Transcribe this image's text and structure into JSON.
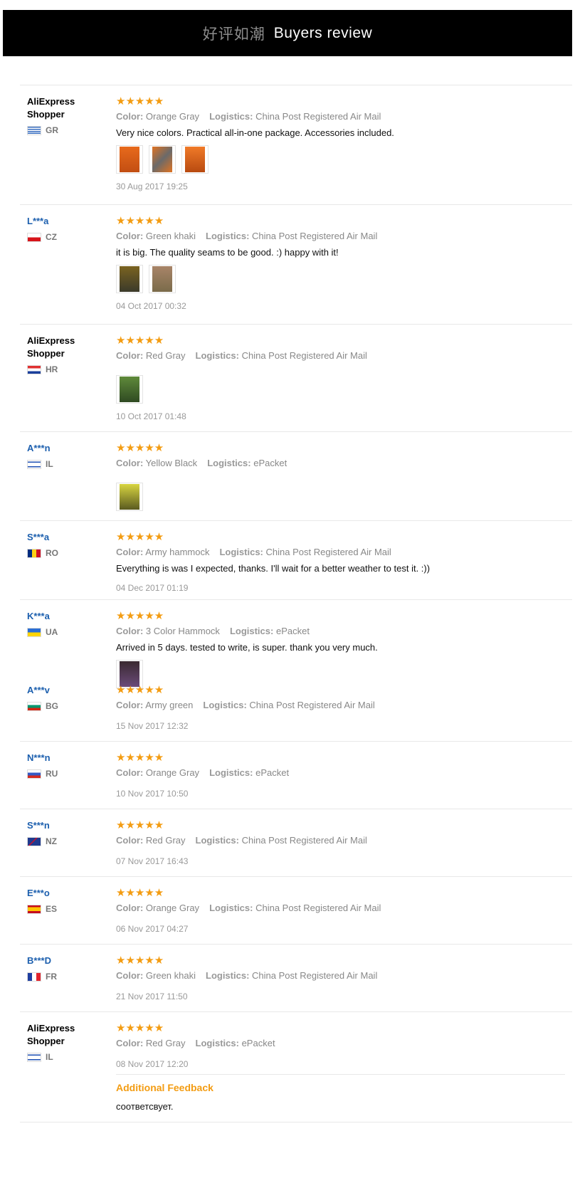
{
  "header": {
    "title_cn": "好评如潮",
    "title_en": "Buyers review"
  },
  "labels": {
    "color": "Color:",
    "logistics": "Logistics:",
    "stars": "★★★★★",
    "additional": "Additional Feedback"
  },
  "colors": {
    "accent": "#f39c12",
    "masked_name": "#1c5fae",
    "banner_bg": "#000000"
  },
  "reviews": [
    {
      "name": "AliExpress Shopper",
      "country": "GR",
      "color": "Orange Gray",
      "logistics": "China Post Registered Air Mail",
      "text": "Very nice colors. Practical all-in-one package. Accessories included.",
      "photos": 3,
      "date": "30 Aug 2017 19:25"
    },
    {
      "name": "L***a",
      "country": "CZ",
      "color": "Green khaki",
      "logistics": "China Post Registered Air Mail",
      "text": "it is big. The quality seams to be good. :) happy with it!",
      "photos": 2,
      "date": "04 Oct 2017 00:32"
    },
    {
      "name": "AliExpress Shopper",
      "country": "HR",
      "color": "Red Gray",
      "logistics": "China Post Registered Air Mail",
      "text": "",
      "photos": 1,
      "date": "10 Oct 2017 01:48"
    },
    {
      "name": "A***n",
      "country": "IL",
      "color": "Yellow Black",
      "logistics": "ePacket",
      "text": "",
      "photos": 1,
      "date": ""
    },
    {
      "name": "S***a",
      "country": "RO",
      "color": "Army hammock",
      "logistics": "China Post Registered Air Mail",
      "text": "Everything is was I expected, thanks. I'll wait for a better weather to test it. :))",
      "photos": 0,
      "date": "04 Dec 2017 01:19"
    },
    {
      "name": "K***a",
      "country": "UA",
      "color": "3 Color Hammock",
      "logistics": "ePacket",
      "text": "Arrived in 5 days. tested to write, is super. thank you very much.",
      "photos": 1,
      "date": ""
    },
    {
      "name": "A***v",
      "country": "BG",
      "color": "Army green",
      "logistics": "China Post Registered Air Mail",
      "text": "",
      "photos": 0,
      "date": "15 Nov 2017 12:32"
    },
    {
      "name": "N***n",
      "country": "RU",
      "color": "Orange Gray",
      "logistics": "ePacket",
      "text": "",
      "photos": 0,
      "date": "10 Nov 2017 10:50"
    },
    {
      "name": "S***n",
      "country": "NZ",
      "color": "Red Gray",
      "logistics": "China Post Registered Air Mail",
      "text": "",
      "photos": 0,
      "date": "07 Nov 2017 16:43"
    },
    {
      "name": "E***o",
      "country": "ES",
      "color": "Orange Gray",
      "logistics": "China Post Registered Air Mail",
      "text": "",
      "photos": 0,
      "date": "06 Nov 2017 04:27"
    },
    {
      "name": "B***D",
      "country": "FR",
      "color": "Green khaki",
      "logistics": "China Post Registered Air Mail",
      "text": "",
      "photos": 0,
      "date": "21 Nov 2017 11:50"
    },
    {
      "name": "AliExpress Shopper",
      "country": "IL",
      "color": "Red Gray",
      "logistics": "ePacket",
      "text": "",
      "photos": 0,
      "date": "08 Nov 2017 12:20",
      "additional_feedback": "соответсвует."
    }
  ]
}
